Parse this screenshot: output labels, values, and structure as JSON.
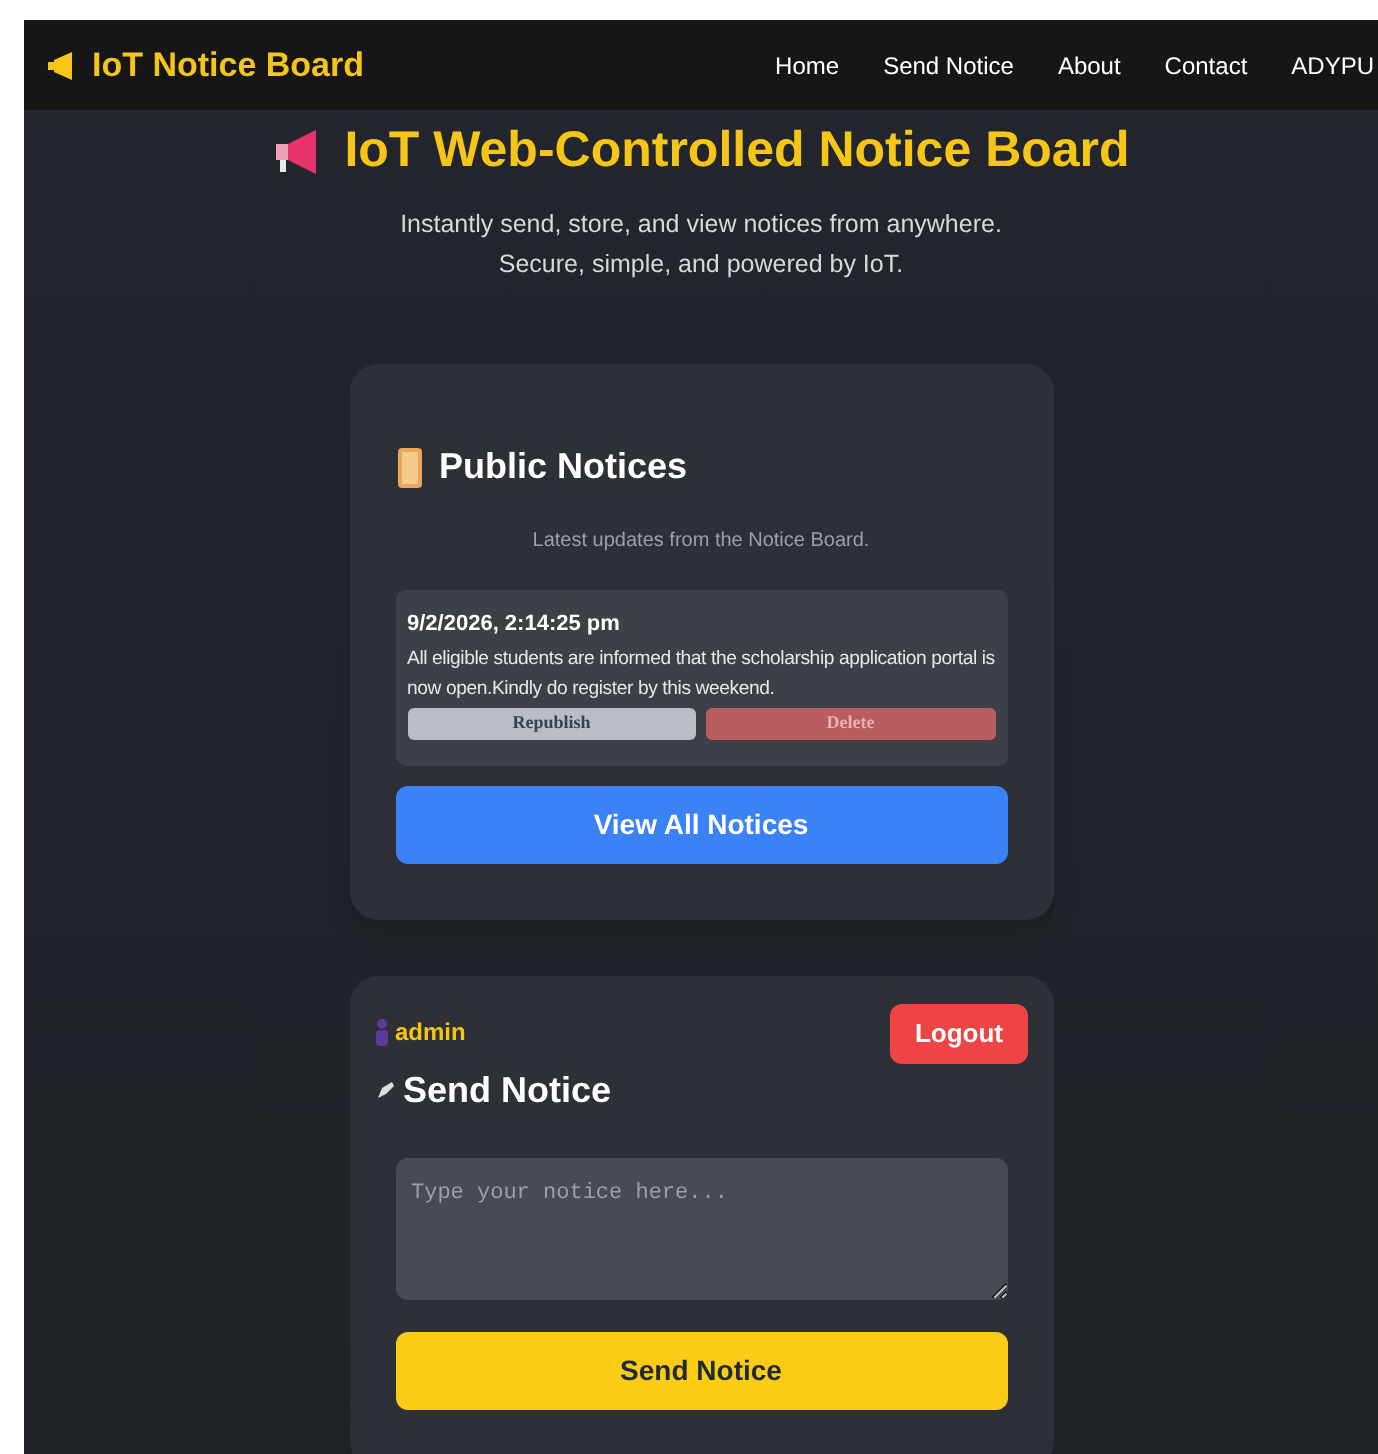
{
  "navbar": {
    "brand": "IoT Notice Board",
    "links": [
      {
        "label": "Home"
      },
      {
        "label": "Send Notice"
      },
      {
        "label": "About"
      },
      {
        "label": "Contact"
      },
      {
        "label": "ADYPU"
      }
    ]
  },
  "hero": {
    "title": "IoT Web-Controlled Notice Board",
    "subtitle_lines": [
      "Instantly send, store, and view notices from anywhere.",
      "Secure, simple, and powered by IoT."
    ]
  },
  "public_notices": {
    "title": "Public Notices",
    "subtitle": "Latest updates from the Notice Board.",
    "notices": [
      {
        "timestamp": "9/2/2026, 2:14:25 pm",
        "text": "All eligible students are informed that the scholarship application portal is now open.Kindly do register by this weekend.",
        "actions": [
          {
            "kind": "republish",
            "label": "Republish"
          },
          {
            "kind": "delete",
            "label": "Delete"
          }
        ]
      }
    ],
    "view_all_button": "View All Notices"
  },
  "send_notice": {
    "user": "admin",
    "logout_button": "Logout",
    "title": "Send Notice",
    "placeholder": "Type your notice here...",
    "submit_button": "Send Notice"
  }
}
